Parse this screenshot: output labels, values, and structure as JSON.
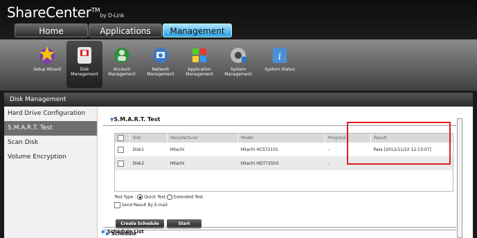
{
  "brand": {
    "name": "ShareCenter",
    "tm": "TM",
    "by": "by D-Link"
  },
  "nav": {
    "tabs": [
      {
        "label": "Home"
      },
      {
        "label": "Applications"
      },
      {
        "label": "Management"
      }
    ]
  },
  "tools": [
    {
      "label": "Setup Wizard",
      "icon": "wizard-icon"
    },
    {
      "label": "Disk Management",
      "icon": "disk-icon"
    },
    {
      "label": "Account Management",
      "icon": "account-icon"
    },
    {
      "label": "Network Management",
      "icon": "network-icon"
    },
    {
      "label": "Application Management",
      "icon": "application-icon"
    },
    {
      "label": "System Management",
      "icon": "system-icon"
    },
    {
      "label": "System Status",
      "icon": "info-icon"
    }
  ],
  "panel": {
    "title": "Disk Management"
  },
  "sidebar": {
    "items": [
      {
        "label": "Hard Drive Configuration"
      },
      {
        "label": "S.M.A.R.T. Test"
      },
      {
        "label": "Scan Disk"
      },
      {
        "label": "Volume Encryption"
      }
    ]
  },
  "smart": {
    "title": "S.M.A.R.T. Test",
    "columns": [
      "Slot",
      "Manufacturer",
      "Model",
      "Progress",
      "Result"
    ],
    "rows": [
      {
        "slot": "Disk1",
        "manufacturer": "Hitachi",
        "model": "Hitachi HCS72101",
        "progress": "-",
        "result": "Pass [2012/11/22 12:13:07]"
      },
      {
        "slot": "Disk2",
        "manufacturer": "Hitachi",
        "model": "Hitachi HDT72503",
        "progress": "-",
        "result": "-"
      }
    ],
    "test_type_label": "Test Type :",
    "quick_test": "Quick Test",
    "extended_test": "Extended Test",
    "selected_test": "Quick Test",
    "send_email": "Send Result By E-mail",
    "create_schedule": "Create Schedule",
    "start": "Start",
    "schedule": "Schedule",
    "schedule_list": "Schedule List"
  },
  "colors": {
    "accent": "#2a9ee0",
    "highlight": "#e21b1b"
  }
}
